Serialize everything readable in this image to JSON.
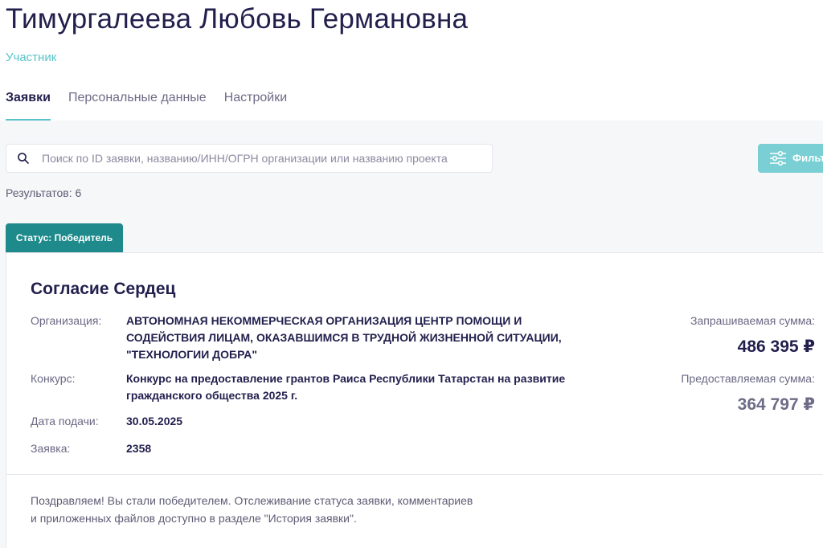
{
  "profile": {
    "name": "Тимургалеева Любовь Германовна",
    "role": "Участник"
  },
  "tabs": [
    {
      "label": "Заявки",
      "active": true
    },
    {
      "label": "Персональные данные",
      "active": false
    },
    {
      "label": "Настройки",
      "active": false
    }
  ],
  "search": {
    "placeholder": "Поиск по ID заявки, названию/ИНН/ОГРН организации или названию проекта",
    "value": "",
    "icon": "search-icon"
  },
  "filter": {
    "label": "Фильтр",
    "icon": "sliders-icon"
  },
  "results": {
    "text": "Результатов: 6"
  },
  "status_tab": {
    "label": "Статус: Победитель"
  },
  "application": {
    "title": "Согласие Сердец",
    "organization_label": "Организация:",
    "organization": "АВТОНОМНАЯ НЕКОММЕРЧЕСКАЯ ОРГАНИЗАЦИЯ ЦЕНТР ПОМОЩИ И СОДЕЙСТВИЯ ЛИЦАМ, ОКАЗАВШИМСЯ В ТРУДНОЙ ЖИЗНЕННОЙ СИТУАЦИИ, \"ТЕХНОЛОГИИ ДОБРА\"",
    "contest_label": "Конкурс:",
    "contest": "Конкурс на предоставление грантов Раиса Республики Татарстан на развитие гражданского общества 2025 г.",
    "date_label": "Дата подачи:",
    "date": "30.05.2025",
    "id_label": "Заявка:",
    "id": "2358",
    "requested_label": "Запрашиваемая сумма:",
    "requested_amount": "486 395 ₽",
    "granted_label": "Предоставляемая сумма:",
    "granted_amount": "364 797 ₽",
    "notice": "Поздравляем! Вы стали победителем. Отслеживание статуса заявки, комментариев и приложенных файлов доступно в разделе \"История заявки\"."
  },
  "colors": {
    "accent": "#57c3c8",
    "status_tab": "#1f8a8b",
    "filter_button": "#79cfd3",
    "text_dark": "#221f4d"
  }
}
